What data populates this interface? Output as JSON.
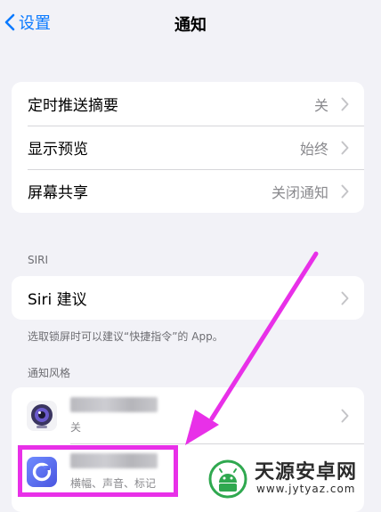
{
  "nav": {
    "back_label": "设置",
    "title": "通知"
  },
  "general_settings": [
    {
      "label": "定时推送摘要",
      "value": "关"
    },
    {
      "label": "显示预览",
      "value": "始终"
    },
    {
      "label": "屏幕共享",
      "value": "关闭通知"
    }
  ],
  "siri": {
    "header": "SIRI",
    "suggestions_label": "Siri 建议",
    "footnote": "选取锁屏时可以建议“快捷指令”的 App。"
  },
  "notification_style": {
    "header": "通知风格",
    "apps": [
      {
        "icon": "camera-app-icon",
        "subtitle": "关"
      },
      {
        "icon": "circle-app-icon",
        "subtitle": "横幅、声音、标记"
      }
    ]
  },
  "watermark": {
    "title": "天源安卓网",
    "url": "www.jytyaz.com"
  },
  "colors": {
    "accent": "#0a7aff",
    "background": "#f2f2f7",
    "annotation": "#e830e8"
  }
}
